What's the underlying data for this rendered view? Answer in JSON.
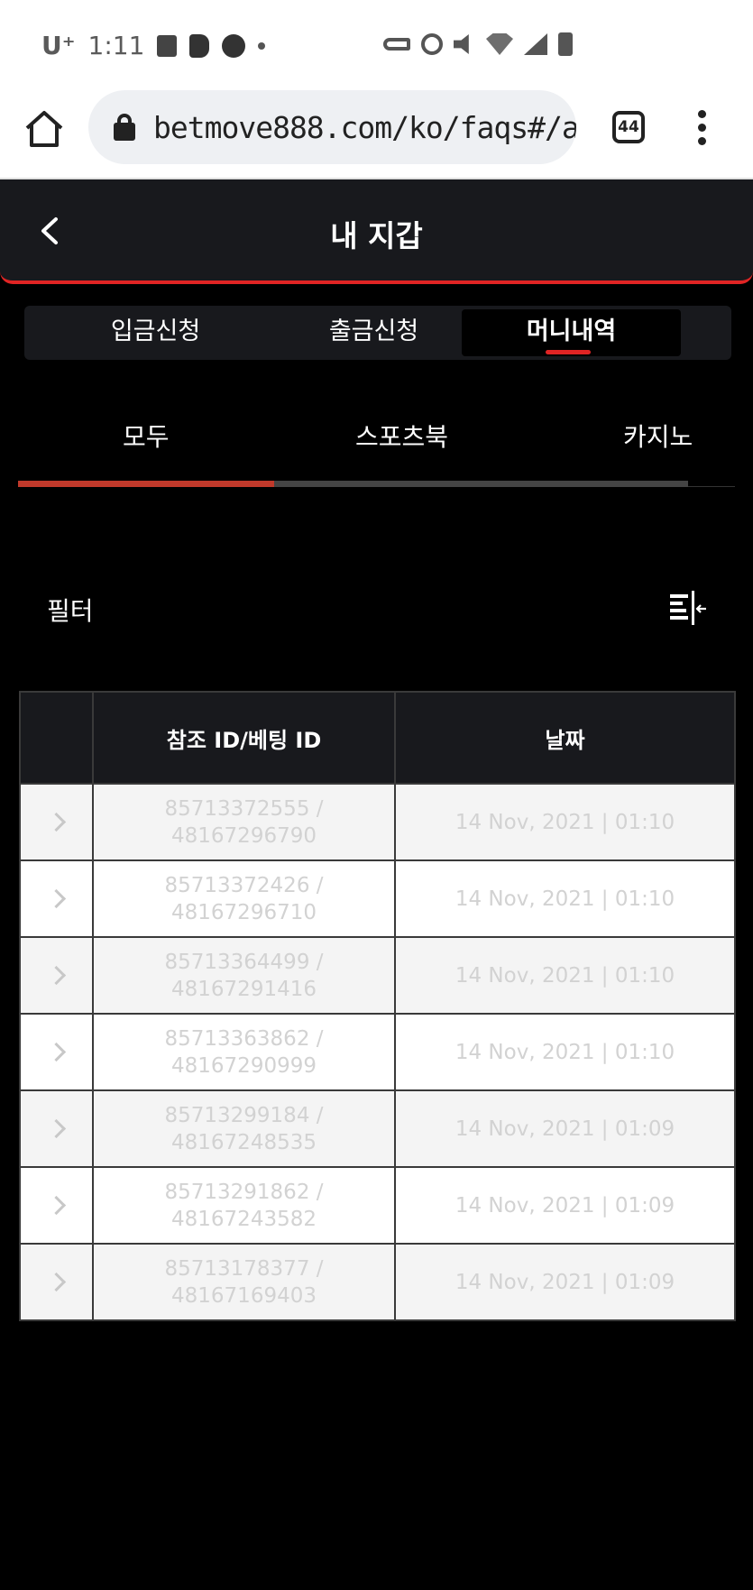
{
  "status_bar": {
    "carrier": "U⁺",
    "time": "1:11"
  },
  "browser": {
    "url": "betmove888.com/ko/faqs#/a",
    "tab_count": "44"
  },
  "header": {
    "title": "내 지갑"
  },
  "segment_tabs": [
    {
      "label": "입금신청",
      "active": false
    },
    {
      "label": "출금신청",
      "active": false
    },
    {
      "label": "머니내역",
      "active": true
    }
  ],
  "category_tabs": [
    {
      "label": "모두",
      "active": true
    },
    {
      "label": "스포츠북",
      "active": false
    },
    {
      "label": "카지노",
      "active": false
    }
  ],
  "filter": {
    "label": "필터"
  },
  "table": {
    "headers": [
      "",
      "참조 ID/베팅 ID",
      "날짜"
    ],
    "rows": [
      {
        "ref_id": "85713372555 /",
        "bet_id": "48167296790",
        "date": "14 Nov, 2021 | 01:10"
      },
      {
        "ref_id": "85713372426 /",
        "bet_id": "48167296710",
        "date": "14 Nov, 2021 | 01:10"
      },
      {
        "ref_id": "85713364499 /",
        "bet_id": "48167291416",
        "date": "14 Nov, 2021 | 01:10"
      },
      {
        "ref_id": "85713363862 /",
        "bet_id": "48167290999",
        "date": "14 Nov, 2021 | 01:10"
      },
      {
        "ref_id": "85713299184 /",
        "bet_id": "48167248535",
        "date": "14 Nov, 2021 | 01:09"
      },
      {
        "ref_id": "85713291862 /",
        "bet_id": "48167243582",
        "date": "14 Nov, 2021 | 01:09"
      },
      {
        "ref_id": "85713178377 /",
        "bet_id": "48167169403",
        "date": "14 Nov, 2021 | 01:09"
      }
    ]
  },
  "colors": {
    "accent": "#e02424",
    "header_bg": "#18191d",
    "page_bg": "#000000"
  }
}
